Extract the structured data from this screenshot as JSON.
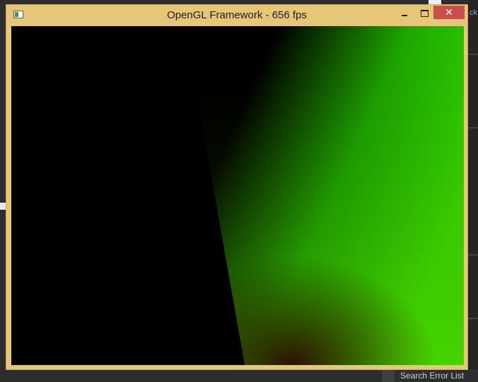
{
  "window": {
    "title": "OpenGL Framework - 656 fps"
  },
  "controls": {
    "close_label": "✕"
  },
  "background": {
    "ide_partial_text": "ck",
    "search_error_list": "Search Error List"
  },
  "render": {
    "colors": {
      "black": "#000000",
      "dark_red": "#2a0000",
      "green_bright": "#33e600",
      "green_mid": "#159a00",
      "green_lower": "#4fc400"
    }
  }
}
